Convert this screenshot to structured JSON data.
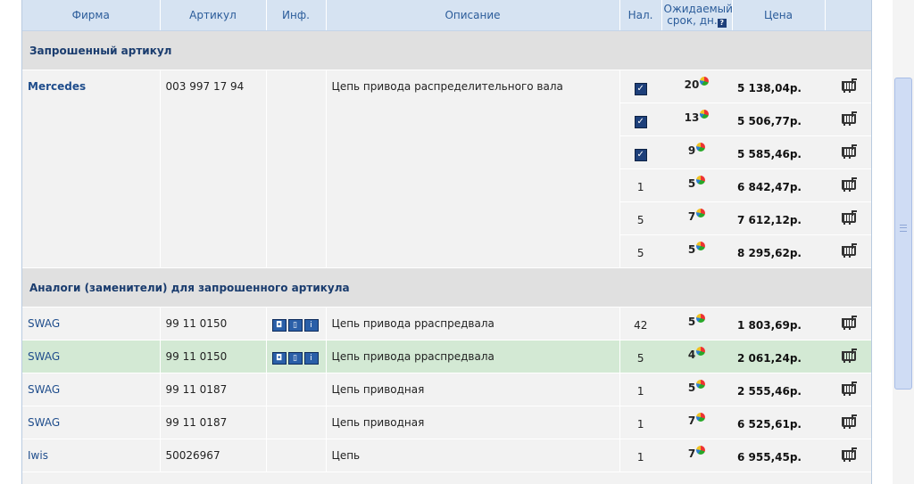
{
  "columns": {
    "firm": "Фирма",
    "article": "Артикул",
    "info": "Инф.",
    "description": "Описание",
    "stock": "Нал.",
    "eta_line1": "Ожидаемый",
    "eta_line2": "срок, дн.",
    "price": "Цена"
  },
  "sections": {
    "requested": "Запрошенный артикул",
    "analogs": "Аналоги (заменители) для запрошенного артикула"
  },
  "requested": {
    "firm": "Mercedes",
    "article": "003 997 17 94",
    "description": "Цепь привода распределительного вала",
    "offers": [
      {
        "stock": "check",
        "eta": "20",
        "price": "5 138,04р."
      },
      {
        "stock": "check",
        "eta": "13",
        "price": "5 506,77р."
      },
      {
        "stock": "check",
        "eta": "9",
        "price": "5 585,46р."
      },
      {
        "stock": "1",
        "eta": "5",
        "price": "6 842,47р."
      },
      {
        "stock": "5",
        "eta": "7",
        "price": "7 612,12р."
      },
      {
        "stock": "5",
        "eta": "5",
        "price": "8 295,62р."
      }
    ]
  },
  "analogs": [
    {
      "firm": "SWAG",
      "article": "99 11 0150",
      "info": true,
      "description": "Цепь привода рраспредвала",
      "stock": "42",
      "eta": "5",
      "price": "1 803,69р.",
      "highlight": false
    },
    {
      "firm": "SWAG",
      "article": "99 11 0150",
      "info": true,
      "description": "Цепь привода рраспредвала",
      "stock": "5",
      "eta": "4",
      "price": "2 061,24р.",
      "highlight": true
    },
    {
      "firm": "SWAG",
      "article": "99 11 0187",
      "info": false,
      "description": "Цепь приводная",
      "stock": "1",
      "eta": "5",
      "price": "2 555,46р.",
      "highlight": false
    },
    {
      "firm": "SWAG",
      "article": "99 11 0187",
      "info": false,
      "description": "Цепь приводная",
      "stock": "1",
      "eta": "7",
      "price": "6 525,61р.",
      "highlight": false
    },
    {
      "firm": "Iwis",
      "article": "50026967",
      "info": false,
      "description": "Цепь",
      "stock": "1",
      "eta": "7",
      "price": "6 955,45р.",
      "highlight": false
    }
  ],
  "icons": {
    "checkbox": "checkbox-checked-icon",
    "eta_chart": "pie-chart-icon",
    "cart": "cart-icon",
    "help": "help-icon",
    "info_set": "info-icons"
  },
  "colors": {
    "header_bg": "#d6e3f2",
    "header_text": "#2b5c9a",
    "section_bg": "#e0e0e0",
    "row_bg": "#f2f2f2",
    "highlight_bg": "#d3e9d4"
  }
}
